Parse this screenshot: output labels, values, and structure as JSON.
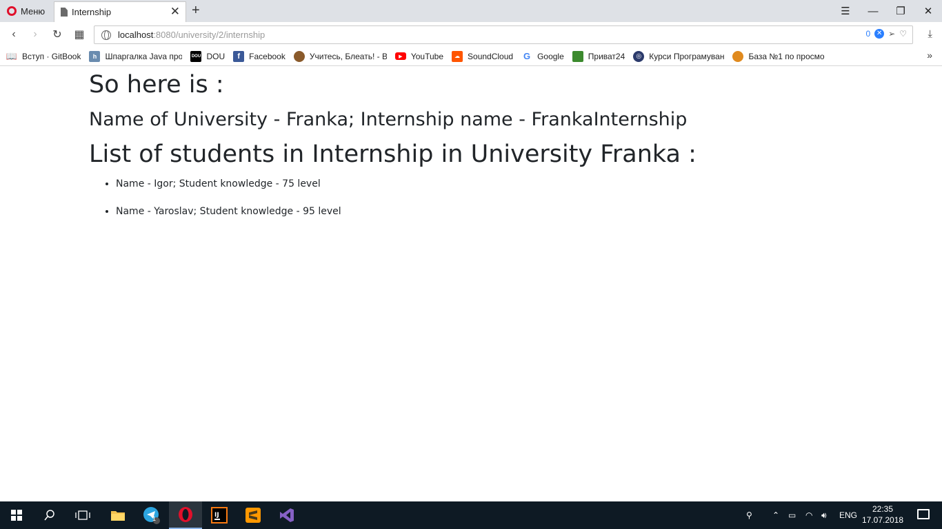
{
  "browser": {
    "menu_label": "Меню",
    "tab_title": "Internship",
    "url_host": "localhost",
    "url_rest": ":8080/university/2/internship",
    "adblock_count": "0"
  },
  "bookmarks": [
    {
      "label": "Вступ · GitBook",
      "icon": "book-icon",
      "color": "#444444"
    },
    {
      "label": "Шпаргалка Java про",
      "icon": "h-icon",
      "color": "#6a8caf"
    },
    {
      "label": "DOU",
      "icon": "dou-icon",
      "color": "#000000"
    },
    {
      "label": "Facebook",
      "icon": "facebook-icon",
      "color": "#3b5998"
    },
    {
      "label": "Учитесь, Блеать! - Ви",
      "icon": "bear-icon",
      "color": "#8a5a2b"
    },
    {
      "label": "YouTube",
      "icon": "youtube-icon",
      "color": "#ff0000"
    },
    {
      "label": "SoundCloud",
      "icon": "soundcloud-icon",
      "color": "#ff5500"
    },
    {
      "label": "Google",
      "icon": "google-icon",
      "color": "#4285f4"
    },
    {
      "label": "Приват24",
      "icon": "privat24-icon",
      "color": "#3c8a2e"
    },
    {
      "label": "Курси Програмуван",
      "icon": "target-icon",
      "color": "#2b3a6b"
    },
    {
      "label": "База №1 по просмо",
      "icon": "tiger-icon",
      "color": "#e08a1e"
    }
  ],
  "page": {
    "intro": "So here is :",
    "info": "Name of University - Franka; Internship name - FrankaInternship",
    "list_heading": "List of students in Internship in University Franka :",
    "students": [
      "Name - Igor; Student knowledge - 75 level",
      "Name - Yaroslav; Student knowledge - 95 level"
    ]
  },
  "taskbar": {
    "language": "ENG",
    "time": "22:35",
    "date": "17.07.2018",
    "telegram_badge": "1"
  }
}
